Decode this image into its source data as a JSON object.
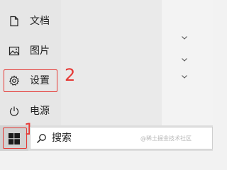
{
  "start_menu": {
    "items": [
      {
        "label": "文档",
        "icon": "document-icon"
      },
      {
        "label": "图片",
        "icon": "pictures-icon"
      },
      {
        "label": "设置",
        "icon": "settings-gear-icon"
      },
      {
        "label": "电源",
        "icon": "power-icon"
      }
    ],
    "right_panel": {
      "chevrons": [
        "chevron-down-icon",
        "chevron-down-icon",
        "chevron-down-icon"
      ]
    }
  },
  "taskbar": {
    "start_icon": "windows-logo-icon",
    "search_icon": "search-icon",
    "search_value": "搜索"
  },
  "annotations": {
    "step_1": "1",
    "step_2": "2",
    "highlight_color": "#e53935"
  },
  "watermark": "@稀土掘金技术社区"
}
